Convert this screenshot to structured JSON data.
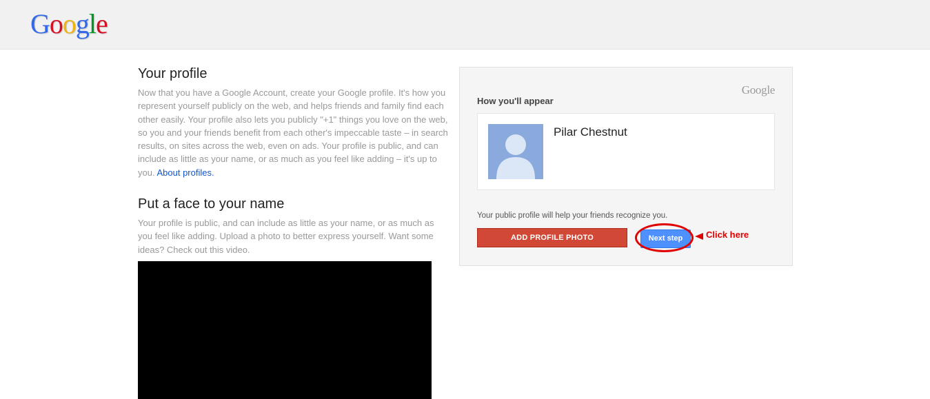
{
  "header": {
    "logo_letters": [
      {
        "ch": "G",
        "color": "#3369e8"
      },
      {
        "ch": "o",
        "color": "#d50f25"
      },
      {
        "ch": "o",
        "color": "#eeb211"
      },
      {
        "ch": "g",
        "color": "#3369e8"
      },
      {
        "ch": "l",
        "color": "#009925"
      },
      {
        "ch": "e",
        "color": "#d50f25"
      }
    ]
  },
  "profile_section": {
    "title": "Your profile",
    "body": "Now that you have a Google Account, create your Google profile. It's how you represent yourself publicly on the web, and helps friends and family find each other easily. Your profile also lets you publicly \"+1\" things you love on the web, so you and your friends benefit from each other's impeccable taste – in search results, on sites across the web, even on ads. Your profile is public, and can include as little as your name, or as much as you feel like adding – it's up to you.",
    "link": "About profiles."
  },
  "face_section": {
    "title": "Put a face to your name",
    "body": "Your profile is public, and can include as little as your name, or as much as you feel like adding. Upload a photo to better express yourself. Want some ideas? Check out this video."
  },
  "card": {
    "logo": "Google",
    "title": "How you'll appear",
    "profile_name": "Pilar Chestnut",
    "helper_text": "Your public profile will help your friends recognize you.",
    "add_photo_label": "Add profile photo",
    "next_label": "Next step"
  },
  "annotation": {
    "label": "Click here"
  },
  "colors": {
    "add_photo_button": "#d14836",
    "next_button": "#4d90fe",
    "annotation": "#e00000",
    "avatar_bg": "#8aa9dc"
  }
}
